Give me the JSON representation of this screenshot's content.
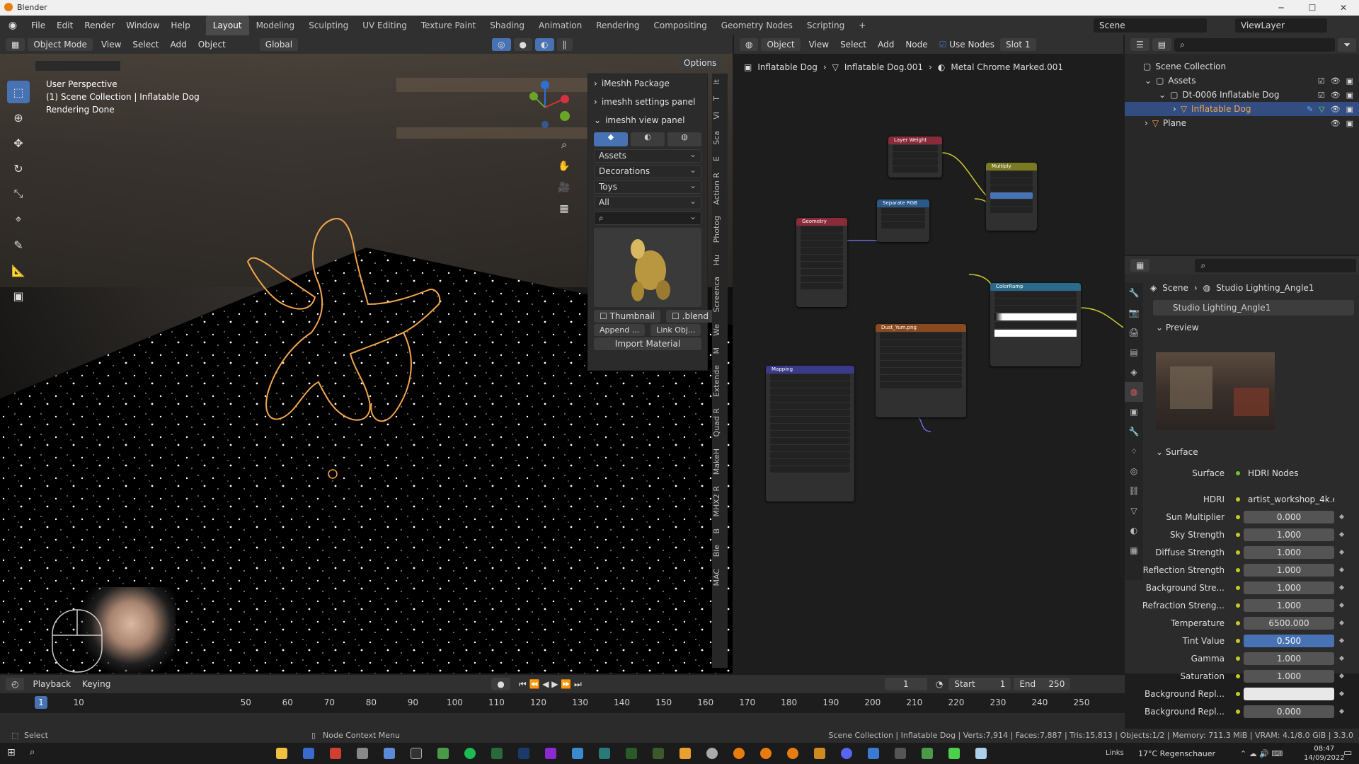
{
  "window": {
    "title": "Blender"
  },
  "menu": {
    "file": "File",
    "edit": "Edit",
    "render": "Render",
    "window": "Window",
    "help": "Help"
  },
  "workspaces": [
    "Layout",
    "Modeling",
    "Sculpting",
    "UV Editing",
    "Texture Paint",
    "Shading",
    "Animation",
    "Rendering",
    "Compositing",
    "Geometry Nodes",
    "Scripting"
  ],
  "scene": {
    "name": "Scene",
    "view_layer": "ViewLayer"
  },
  "viewport": {
    "mode": "Object Mode",
    "menus": [
      "View",
      "Select",
      "Add",
      "Object"
    ],
    "orientation": "Global",
    "options": "Options",
    "info_line1": "User Perspective",
    "info_line2": "(1) Scene Collection | Inflatable Dog",
    "info_line3": "Rendering Done"
  },
  "npanel": {
    "package": "iMeshh Package",
    "settings": "imeshh settings panel",
    "view": "imeshh view panel",
    "dropdowns": [
      "Assets",
      "Decorations",
      "Toys",
      "All"
    ],
    "thumbnail": "Thumbnail",
    "blend": ".blend",
    "append": "Append ...",
    "link": "Link Obj...",
    "import_material": "Import Material",
    "tabs": [
      "It",
      "T",
      "VI",
      "Sca",
      "E",
      "Action R",
      "Photog",
      "Hu",
      "Screenca",
      "We",
      "M",
      "Extende",
      "Quad R",
      "MakeH",
      "MHX2 R",
      "B",
      "Ble",
      "MAC"
    ]
  },
  "node_editor": {
    "object_mode": "Object",
    "menus": [
      "View",
      "Select",
      "Add",
      "Node"
    ],
    "use_nodes": "Use Nodes",
    "slot": "Slot 1",
    "breadcrumb": [
      "Inflatable Dog",
      "Inflatable Dog.001",
      "Metal Chrome Marked.001"
    ],
    "nodes": {
      "layer_weight": "Layer Weight",
      "multiply": "Multiply",
      "separate_rgb": "Separate RGB",
      "geometry": "Geometry",
      "colorramp": "ColorRamp",
      "dust_img": "Dust_Yum.png",
      "mapping": "Mapping"
    }
  },
  "outliner": {
    "root": "Scene Collection",
    "items": [
      {
        "label": "Assets",
        "indent": 1
      },
      {
        "label": "Dt-0006 Inflatable Dog",
        "indent": 2
      },
      {
        "label": "Inflatable Dog",
        "indent": 3
      },
      {
        "label": "Plane",
        "indent": 1
      }
    ]
  },
  "properties": {
    "breadcrumb_scene": "Scene",
    "breadcrumb_world": "Studio Lighting_Angle1",
    "world_name": "Studio Lighting_Angle1",
    "preview": "Preview",
    "surface_header": "Surface",
    "surface_label": "Surface",
    "surface_value": "HDRI Nodes",
    "hdri_label": "HDRI",
    "hdri_value": "artist_workshop_4k.exr...",
    "rows": [
      {
        "label": "Sun Multiplier",
        "value": "0.000"
      },
      {
        "label": "Sky Strength",
        "value": "1.000"
      },
      {
        "label": "Diffuse Strength",
        "value": "1.000"
      },
      {
        "label": "Reflection Strength",
        "value": "1.000"
      },
      {
        "label": "Background Stre...",
        "value": "1.000"
      },
      {
        "label": "Refraction Streng...",
        "value": "1.000"
      },
      {
        "label": "Temperature",
        "value": "6500.000"
      },
      {
        "label": "Tint Value",
        "value": "0.500"
      },
      {
        "label": "Gamma",
        "value": "1.000"
      },
      {
        "label": "Saturation",
        "value": "1.000"
      },
      {
        "label": "Background Repl...",
        "value": ""
      },
      {
        "label": "Background Repl...",
        "value": "0.000"
      }
    ]
  },
  "timeline": {
    "playback": "Playback",
    "keying": "Keying",
    "current": "1",
    "start_label": "Start",
    "start": "1",
    "end_label": "End",
    "end": "250",
    "ticks": [
      "1",
      "10",
      "50",
      "60",
      "70",
      "80",
      "90",
      "100",
      "110",
      "120",
      "130",
      "140",
      "150",
      "160",
      "170",
      "180",
      "190",
      "200",
      "210",
      "220",
      "230",
      "240",
      "250"
    ]
  },
  "status": {
    "select": "Select",
    "context": "Node Context Menu",
    "stats": "Scene Collection | Inflatable Dog | Verts:7,914 | Faces:7,887 | Tris:15,813 | Objects:1/2 | Memory: 711.3 MiB | VRAM: 4.1/8.0 GiB | 3.3.0"
  },
  "taskbar": {
    "links": "Links",
    "weather": "17°C  Regenschauer",
    "time": "08:47",
    "date": "14/09/2022"
  }
}
